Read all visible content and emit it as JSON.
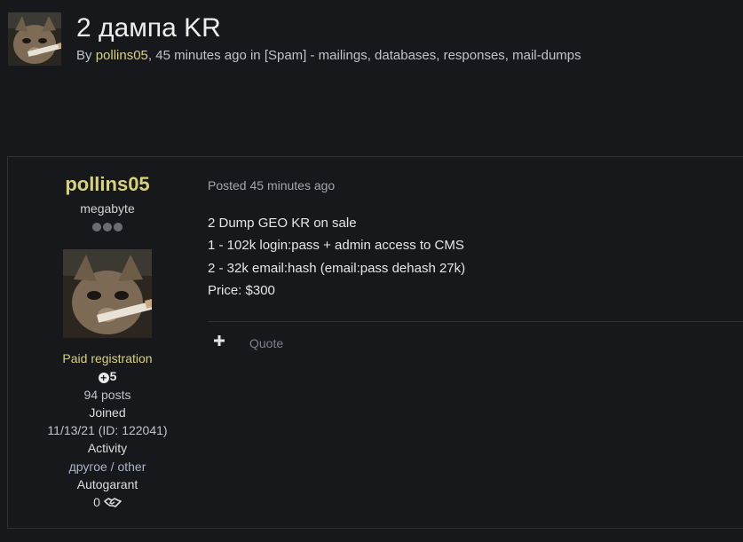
{
  "topic": {
    "title": "2 дампа KR",
    "meta_by": "By ",
    "author": "pollins05",
    "meta_middle": ", 45 minutes ago in ",
    "forum": "[Spam] - mailings, databases, responses, mail-dumps"
  },
  "post": {
    "author": {
      "name": "pollins05",
      "rank": "megabyte",
      "rank_pips": 3,
      "group": "Paid registration",
      "reputation": "5",
      "posts": "94 posts",
      "joined_label": "Joined",
      "joined_value": "11/13/21 (ID: 122041)",
      "activity_label": "Activity",
      "activity_value": "другое / other",
      "autogarant_label": "Autogarant",
      "autogarant_value": "0"
    },
    "posted": "Posted 45 minutes ago",
    "body": [
      "2 Dump GEO KR on sale",
      "1 - 102k login:pass + admin access to CMS",
      "2 - 32k email:hash (email:pass dehash 27k)",
      "Price: $300"
    ],
    "actions": {
      "quote_label": "Quote"
    }
  },
  "icons": {
    "plus": "plus-icon",
    "reputation": "plus-circle-icon",
    "autogarant": "handshake-icon"
  },
  "colors": {
    "background": "#17181c",
    "accent_username": "#d8d27a",
    "border": "#2e3036"
  }
}
